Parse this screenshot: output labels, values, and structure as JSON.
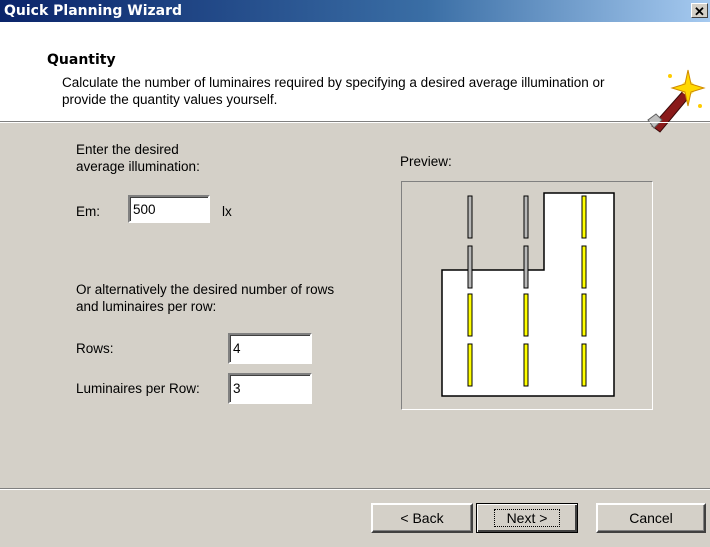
{
  "window": {
    "title": "Quick Planning Wizard",
    "close_glyph": "✕"
  },
  "header": {
    "title": "Quantity",
    "description": "Calculate the number of luminaires required by specifying a desired average illumination or provide the quantity values yourself.",
    "icon": "magic-wand-icon"
  },
  "illumination": {
    "prompt_line1": "Enter the desired",
    "prompt_line2": "average illumination:",
    "em_label": "Em:",
    "em_value": "500",
    "unit": "lx"
  },
  "alternative": {
    "prompt_line1": "Or alternatively the desired number of rows",
    "prompt_line2": "and luminaires per row:",
    "rows_label": "Rows:",
    "rows_value": "4",
    "per_row_label": "Luminaires per Row:",
    "per_row_value": "3"
  },
  "preview": {
    "label": "Preview:",
    "rows": 4,
    "luminaires_per_row": 3,
    "colors": {
      "active": "#ffff00",
      "inactive": "#b8b8b8",
      "room_fill": "#ffffff",
      "outline": "#000000"
    }
  },
  "buttons": {
    "back": "< Back",
    "next": "Next >",
    "cancel": "Cancel"
  }
}
